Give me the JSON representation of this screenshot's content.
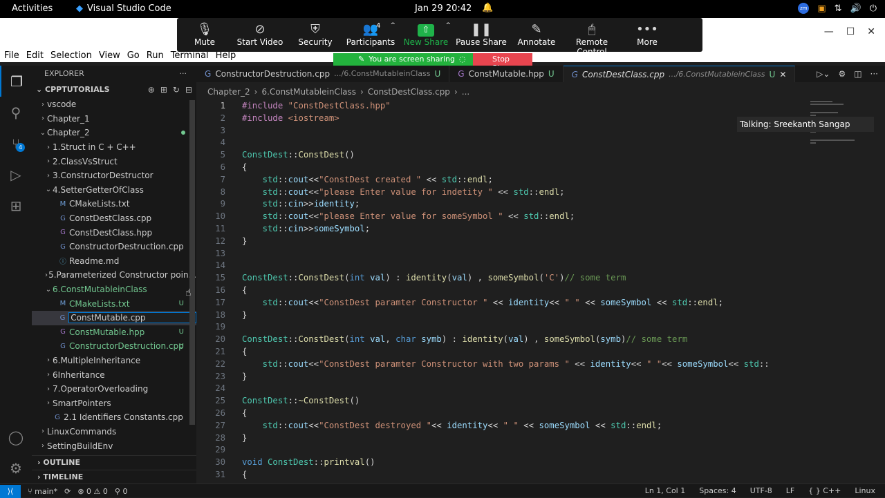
{
  "topbar": {
    "activities": "Activities",
    "app": "Visual Studio Code",
    "datetime": "Jan 29  20:42"
  },
  "zoom": {
    "items": [
      {
        "id": "mute",
        "icon": "mic-icon",
        "label": "Mute"
      },
      {
        "id": "video",
        "icon": "video-off-icon",
        "label": "Start Video"
      },
      {
        "id": "security",
        "icon": "shield-icon",
        "label": "Security"
      },
      {
        "id": "participants",
        "icon": "people-icon",
        "label": "Participants",
        "count": "4"
      },
      {
        "id": "newshare",
        "icon": "share-up-icon",
        "label": "New Share"
      },
      {
        "id": "pause",
        "icon": "pause-icon",
        "label": "Pause Share"
      },
      {
        "id": "annotate",
        "icon": "pencil-icon",
        "label": "Annotate"
      },
      {
        "id": "remote",
        "icon": "mouse-icon",
        "label": "Remote Control"
      },
      {
        "id": "more",
        "icon": "more-icon",
        "label": "More"
      }
    ],
    "sharing": "You are screen sharing",
    "stop": "Stop Share"
  },
  "menu": [
    "File",
    "Edit",
    "Selection",
    "View",
    "Go",
    "Run",
    "Terminal",
    "Help"
  ],
  "explorer": {
    "title": "EXPLORER",
    "project": "CPPTUTORIALS",
    "rows": [
      {
        "indent": 1,
        "tw": "›",
        "label": "vscode",
        "fi": "",
        "cls": ""
      },
      {
        "indent": 1,
        "tw": "›",
        "label": "Chapter_1",
        "fi": "",
        "cls": ""
      },
      {
        "indent": 1,
        "tw": "⌄",
        "label": "Chapter_2",
        "fi": "",
        "cls": ""
      },
      {
        "indent": 2,
        "tw": "›",
        "label": "1.Struct in C + C++",
        "fi": "",
        "cls": ""
      },
      {
        "indent": 2,
        "tw": "›",
        "label": "2.ClassVsStruct",
        "fi": "",
        "cls": ""
      },
      {
        "indent": 2,
        "tw": "›",
        "label": "3.ConstructorDestructor",
        "fi": "",
        "cls": ""
      },
      {
        "indent": 2,
        "tw": "⌄",
        "label": "4.SetterGetterOfClass",
        "fi": "",
        "cls": ""
      },
      {
        "indent": 3,
        "tw": "",
        "label": "CMakeLists.txt",
        "fi": "M",
        "cls": "c-m"
      },
      {
        "indent": 3,
        "tw": "",
        "label": "ConstDestClass.cpp",
        "fi": "G",
        "cls": "c-cpp"
      },
      {
        "indent": 3,
        "tw": "",
        "label": "ConstDestClass.hpp",
        "fi": "G",
        "cls": "c-h"
      },
      {
        "indent": 3,
        "tw": "",
        "label": "ConstructorDestruction.cpp",
        "fi": "G",
        "cls": "c-cpp"
      },
      {
        "indent": 3,
        "tw": "",
        "label": "Readme.md",
        "fi": "ⓘ",
        "cls": "c-i"
      },
      {
        "indent": 2,
        "tw": "›",
        "label": "5.Parameterized Constructor poin...",
        "fi": "",
        "cls": ""
      },
      {
        "indent": 2,
        "tw": "⌄",
        "label": "6.ConstMutableinClass",
        "fi": "",
        "cls": "",
        "green": true
      },
      {
        "indent": 3,
        "tw": "",
        "label": "CMakeLists.txt",
        "fi": "M",
        "cls": "c-m",
        "green": true,
        "badge": "U"
      },
      {
        "indent": 3,
        "tw": "",
        "label": "ConstMutable.cpp",
        "fi": "G",
        "cls": "c-cpp",
        "edit": true
      },
      {
        "indent": 3,
        "tw": "",
        "label": "ConstMutable.hpp",
        "fi": "G",
        "cls": "c-h",
        "green": true,
        "badge": "U"
      },
      {
        "indent": 3,
        "tw": "",
        "label": "ConstructorDestruction.cpp",
        "fi": "G",
        "cls": "c-cpp",
        "green": true,
        "badge": "U"
      },
      {
        "indent": 2,
        "tw": "›",
        "label": "6.MultipleInheritance",
        "fi": "",
        "cls": ""
      },
      {
        "indent": 2,
        "tw": "›",
        "label": "6Inheritance",
        "fi": "",
        "cls": ""
      },
      {
        "indent": 2,
        "tw": "›",
        "label": "7.OperatorOverloading",
        "fi": "",
        "cls": ""
      },
      {
        "indent": 2,
        "tw": "›",
        "label": "SmartPointers",
        "fi": "",
        "cls": ""
      },
      {
        "indent": 2,
        "tw": "",
        "label": "2.1 Identifiers Constants.cpp",
        "fi": "G",
        "cls": "c-cpp"
      },
      {
        "indent": 1,
        "tw": "›",
        "label": "LinuxCommands",
        "fi": "",
        "cls": ""
      },
      {
        "indent": 1,
        "tw": "›",
        "label": "SettingBuildEnv",
        "fi": "",
        "cls": ""
      }
    ],
    "outline": "OUTLINE",
    "timeline": "TIMELINE"
  },
  "tabs": [
    {
      "name": "ConstructorDestruction.cpp",
      "path": ".../6.ConstMutableinClass",
      "u": "U",
      "active": false,
      "icon_cls": "c-cpp"
    },
    {
      "name": "ConstMutable.hpp",
      "path": "",
      "u": "U",
      "active": false,
      "icon_cls": "c-h"
    },
    {
      "name": "ConstDestClass.cpp",
      "path": ".../6.ConstMutableinClass",
      "u": "U",
      "active": true,
      "icon_cls": "c-cpp"
    }
  ],
  "breadcrumb": [
    "Chapter_2",
    "6.ConstMutableinClass",
    "ConstDestClass.cpp",
    "..."
  ],
  "code": [
    "<span class='pp'>#include</span> <span class='str'>\"ConstDestClass.hpp\"</span>",
    "<span class='pp'>#include</span> <span class='str'>&lt;iostream&gt;</span>",
    "",
    "",
    "<span class='cls'>ConstDest</span>::<span class='fn'>ConstDest</span>()",
    "{",
    "    <span class='cls'>std</span>::<span class='var'>cout</span>&lt;&lt;<span class='str'>\"ConstDest created \"</span> &lt;&lt; <span class='cls'>std</span>::<span class='fn'>endl</span>;",
    "    <span class='cls'>std</span>::<span class='var'>cout</span>&lt;&lt;<span class='str'>\"please Enter value for indetity \"</span> &lt;&lt; <span class='cls'>std</span>::<span class='fn'>endl</span>;",
    "    <span class='cls'>std</span>::<span class='var'>cin</span>&gt;&gt;<span class='var'>identity</span>;",
    "    <span class='cls'>std</span>::<span class='var'>cout</span>&lt;&lt;<span class='str'>\"please Enter value for someSymbol \"</span> &lt;&lt; <span class='cls'>std</span>::<span class='fn'>endl</span>;",
    "    <span class='cls'>std</span>::<span class='var'>cin</span>&gt;&gt;<span class='var'>someSymbol</span>;",
    "}",
    "",
    "",
    "<span class='cls'>ConstDest</span>::<span class='fn'>ConstDest</span>(<span class='kw'>int</span> <span class='var'>val</span>) : <span class='fn'>identity</span>(<span class='var'>val</span>) , <span class='fn'>someSymbol</span>(<span class='str'>'C'</span>)<span class='com'>// some term</span>",
    "{",
    "    <span class='cls'>std</span>::<span class='var'>cout</span>&lt;&lt;<span class='str'>\"ConstDest paramter Constructor \"</span> &lt;&lt; <span class='var'>identity</span>&lt;&lt; <span class='str'>\" \"</span> &lt;&lt; <span class='var'>someSymbol</span> &lt;&lt; <span class='cls'>std</span>::<span class='fn'>endl</span>;",
    "}",
    "",
    "<span class='cls'>ConstDest</span>::<span class='fn'>ConstDest</span>(<span class='kw'>int</span> <span class='var'>val</span>, <span class='kw'>char</span> <span class='var'>symb</span>) : <span class='fn'>identity</span>(<span class='var'>val</span>) , <span class='fn'>someSymbol</span>(<span class='var'>symb</span>)<span class='com'>// some term</span>",
    "{",
    "    <span class='cls'>std</span>::<span class='var'>cout</span>&lt;&lt;<span class='str'>\"ConstDest paramter Constructor with two params \"</span> &lt;&lt; <span class='var'>identity</span>&lt;&lt; <span class='str'>\" \"</span>&lt;&lt; <span class='var'>someSymbol</span>&lt;&lt; <span class='cls'>std</span>::",
    "}",
    "",
    "<span class='cls'>ConstDest</span>::<span class='fn'>~ConstDest</span>()",
    "{",
    "    <span class='cls'>std</span>::<span class='var'>cout</span>&lt;&lt;<span class='str'>\"ConstDest destroyed \"</span>&lt;&lt; <span class='var'>identity</span>&lt;&lt; <span class='str'>\" \"</span> &lt;&lt; <span class='var'>someSymbol</span> &lt;&lt; <span class='cls'>std</span>::<span class='fn'>endl</span>;",
    "}",
    "",
    "<span class='kw'>void</span> <span class='cls'>ConstDest</span>::<span class='fn'>printval</span>()",
    "{"
  ],
  "talking": "Talking: Sreekanth Sangap",
  "status": {
    "branch": "main*",
    "sync": "⟳",
    "problems": "⊗ 0 ⚠ 0",
    "ports": "⚲ 0",
    "position": "Ln 1, Col 1",
    "spaces": "Spaces: 4",
    "encoding": "UTF-8",
    "eol": "LF",
    "lang": "{ } C++",
    "os": "Linux"
  }
}
